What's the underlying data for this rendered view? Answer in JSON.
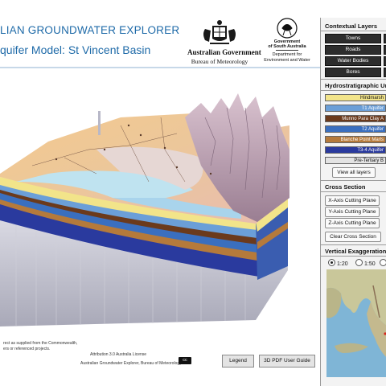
{
  "header": {
    "title": "LIAN GROUNDWATER EXPLORER",
    "subtitle": "quifer Model: St Vincent Basin",
    "gov_aus": "Australian Government",
    "bom": "Bureau of Meteorology",
    "gov_sa": "Government of South Australia",
    "gov_sa_1": "Government",
    "gov_sa_2": "of South Australia",
    "dept_1": "Department for",
    "dept_2": "Environment and Water"
  },
  "contextual_layers": {
    "title": "Contextual Layers",
    "items": [
      "Towns",
      "Roads",
      "Water Bodies",
      "Bores"
    ]
  },
  "hydro_units": {
    "title": "Hydrostratigraphic Units",
    "items": [
      {
        "label": "Hindmarsh",
        "color": "#f2e48a",
        "text": "#111111"
      },
      {
        "label": "T1 Aquifer",
        "color": "#6b9fd8",
        "text": "#ffffff"
      },
      {
        "label": "Munno Para Clay A",
        "color": "#6b3a1c",
        "text": "#ffffff"
      },
      {
        "label": "T2 Aquifer",
        "color": "#3a6fbf",
        "text": "#ffffff"
      },
      {
        "label": "Blanche Point Marls",
        "color": "#b57a3b",
        "text": "#ffffff"
      },
      {
        "label": "T3-4 Aquifer",
        "color": "#2a3a9e",
        "text": "#ffffff"
      },
      {
        "label": "Pre-Tertiary B",
        "color": "#e3e3e3",
        "text": "#111111"
      }
    ],
    "view_all": "View all layers"
  },
  "cross_section": {
    "title": "Cross Section",
    "buttons": [
      "X-Axis Cutting Plane",
      "Y-Axis Cutting Plane",
      "Z-Axis Cutting Plane"
    ],
    "clear": "Clear Cross Section"
  },
  "vertical_exaggeration": {
    "title": "Vertical Exaggeration",
    "options": [
      "1:20",
      "1:50",
      "1"
    ],
    "selected": "1:20"
  },
  "footer": {
    "credit_1": "rect as supplied from the Commonwealth,",
    "credit_2": "ers or referenced projects.",
    "license_1": "Attribution 3.0 Australia License",
    "license_2": "Australian Groundwater Explorer, Bureau of Meteorology",
    "cc": "cc",
    "legend_btn": "Legend",
    "guide_btn": "3D PDF User Guide"
  },
  "colors": {
    "title_blue": "#1e6aa8",
    "context_btn": "#2d2d2d",
    "panel_bg": "#f3f3f3"
  }
}
